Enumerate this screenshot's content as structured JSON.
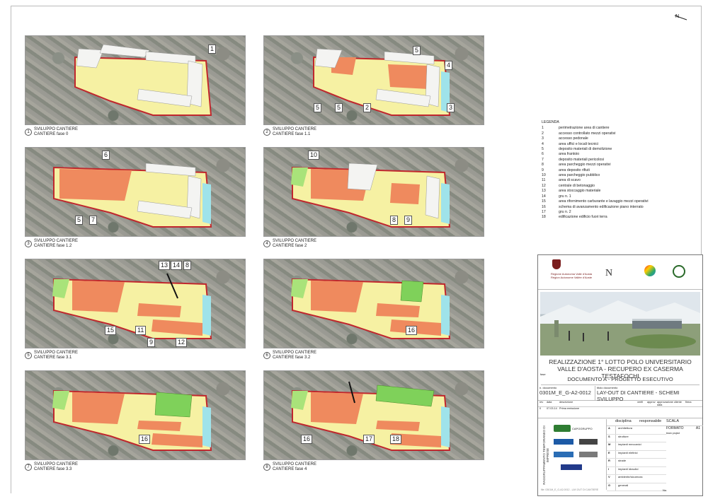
{
  "panels": [
    {
      "id": "1",
      "caption_title": "SVILUPPO CANTIERE",
      "caption_sub": "CANTIERE fase 0"
    },
    {
      "id": "2",
      "caption_title": "SVILUPPO CANTIERE",
      "caption_sub": "CANTIERE fase 1.1"
    },
    {
      "id": "3",
      "caption_title": "SVILUPPO CANTIERE",
      "caption_sub": "CANTIERE fase 1.2"
    },
    {
      "id": "4",
      "caption_title": "SVILUPPO CANTIERE",
      "caption_sub": "CANTIERE fase 2"
    },
    {
      "id": "5",
      "caption_title": "SVILUPPO CANTIERE",
      "caption_sub": "CANTIERE fase 3.1"
    },
    {
      "id": "6",
      "caption_title": "SVILUPPO CANTIERE",
      "caption_sub": "CANTIERE fase 3.2"
    },
    {
      "id": "7",
      "caption_title": "SVILUPPO CANTIERE",
      "caption_sub": "CANTIERE fase 3.3"
    },
    {
      "id": "8",
      "caption_title": "SVILUPPO CANTIERE",
      "caption_sub": "CANTIERE fase 4"
    }
  ],
  "callouts": {
    "p1": [
      "1"
    ],
    "p2": [
      "5",
      "4",
      "5",
      "5",
      "2",
      "3"
    ],
    "p3": [
      "6",
      "5",
      "7"
    ],
    "p4": [
      "10",
      "8",
      "9"
    ],
    "p5": [
      "13",
      "14",
      "8",
      "15",
      "11",
      "9",
      "12"
    ],
    "p6": [
      "16"
    ],
    "p7": [
      "16"
    ],
    "p8": [
      "16",
      "17",
      "18"
    ]
  },
  "legend": {
    "title": "LEGENDA",
    "items": [
      {
        "n": "1",
        "t": "perimetrazione area di cantiere"
      },
      {
        "n": "2",
        "t": "accesso controllato mezzi operativi"
      },
      {
        "n": "3",
        "t": "accesso pedonale"
      },
      {
        "n": "4",
        "t": "area uffici e locali tecnici"
      },
      {
        "n": "5",
        "t": "deposito materiali di demolizione"
      },
      {
        "n": "6",
        "t": "area frantoio"
      },
      {
        "n": "7",
        "t": "deposito materiali pericolosi"
      },
      {
        "n": "8",
        "t": "area parcheggio mezzi operativi"
      },
      {
        "n": "9",
        "t": "area deposito rifiuti"
      },
      {
        "n": "10",
        "t": "area parcheggio pubblico"
      },
      {
        "n": "11",
        "t": "area di scavo"
      },
      {
        "n": "12",
        "t": "centrale di betonaggio"
      },
      {
        "n": "13",
        "t": "area stoccaggio materiale"
      },
      {
        "n": "14",
        "t": "gru n. 1"
      },
      {
        "n": "15",
        "t": "area rifornimento carburante e lavaggio mezzi operativi"
      },
      {
        "n": "16",
        "t": "schema di avanzamento edificazione piano interrato"
      },
      {
        "n": "17",
        "t": "gru n. 2"
      },
      {
        "n": "18",
        "t": "edificazione edificio fuori terra"
      }
    ]
  },
  "titleblock": {
    "logo_text_1": "Regione Autonoma Valle d'Aosta",
    "logo_text_2": "Région Autonome Vallée d'Aoste",
    "project_title": "REALIZZAZIONE 1° LOTTO POLO UNIVERSITARIO VALLE D'AOSTA - RECUPERO EX CASERMA TESTAFOCHI",
    "doc_label": "fase",
    "doc_phase": "DOCUMENTO A - PROGETTO ESECUTIVO",
    "n_documento_label": "n. documento",
    "n_documento": "0301M_E_G-A2-0012",
    "titolo_label": "titolo documento",
    "titolo": "LAY-OUT DI CANTIERE - SCHEMI SVILUPPO",
    "rev_headers": [
      "rev",
      "data",
      "descrizione",
      "verifi",
      "approv",
      "approvazione cliente data",
      "firma"
    ],
    "rev_row": [
      "0",
      "07.03.14",
      "Prima emissione"
    ],
    "rti_label": "RAGGRUPPAMENTO TEMPORANEO DI IMPRESE",
    "capogruppo": "CAPOGRUPPO",
    "disciplina_header": "disciplina",
    "responsabile_header": "responsabile",
    "scala_label": "SCALA",
    "formato_label": "FORMATO",
    "formato": "A1",
    "team_project": "team project",
    "disciplines": [
      {
        "k": "A",
        "v": "architettura"
      },
      {
        "k": "S",
        "v": "strutture"
      },
      {
        "k": "M",
        "v": "impianti meccanici"
      },
      {
        "k": "E",
        "v": "impianti elettrici"
      },
      {
        "k": "R",
        "v": "strade"
      },
      {
        "k": "I",
        "v": "impianti idraulici"
      },
      {
        "k": "V",
        "v": "ambiente/sicurezza"
      },
      {
        "k": "G",
        "v": "generali"
      }
    ],
    "footer": "file: 0301M_E_G-A2-0012 - LAY-OUT DI CANTIERE",
    "no_label": "No."
  },
  "colors": {
    "perimeter": "#c0272d",
    "yellow": "#f6f1a3",
    "orange": "#ef8a5e",
    "green": "#a9e37a",
    "cyan": "#9fe3ea",
    "building": "#f4f4f2"
  }
}
